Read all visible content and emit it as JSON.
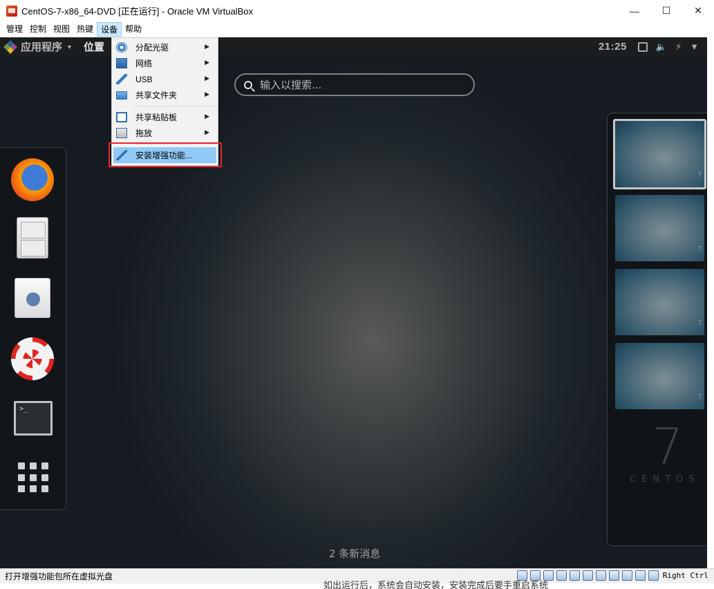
{
  "window": {
    "title": "CentOS-7-x86_64-DVD [正在运行] - Oracle VM VirtualBox",
    "minimize": "—",
    "maximize": "☐",
    "close": "✕"
  },
  "menubar": {
    "items": [
      "管理",
      "控制",
      "视图",
      "热键",
      "设备",
      "帮助"
    ],
    "active_index": 4
  },
  "guest": {
    "top_panel": {
      "apps_label": "应用程序",
      "places_label": "位置",
      "clock": "21:25"
    },
    "search": {
      "placeholder": "输入以搜索..."
    },
    "dash_apps": [
      "firefox-icon",
      "files-icon",
      "software-icon",
      "help-icon",
      "terminal-icon"
    ],
    "terminal_prompt": ">_",
    "workspace_count": 4,
    "workspace_mark": "7",
    "watermark": {
      "number": "7",
      "word": "CENTOS"
    },
    "notifications": "2 条新消息"
  },
  "devices_menu": {
    "items": [
      {
        "label": "分配光驱",
        "icon": "optical-drive-icon",
        "submenu": true
      },
      {
        "label": "网络",
        "icon": "network-icon",
        "submenu": true
      },
      {
        "label": "USB",
        "icon": "usb-icon",
        "submenu": true
      },
      {
        "label": "共享文件夹",
        "icon": "shared-folder-icon",
        "submenu": true
      },
      {
        "label": "共享粘贴板",
        "icon": "clipboard-icon",
        "submenu": true
      },
      {
        "label": "拖放",
        "icon": "drag-drop-icon",
        "submenu": true
      },
      {
        "label": "安装增强功能...",
        "icon": "guest-additions-icon",
        "submenu": false,
        "highlighted": true
      }
    ],
    "highlight_color": "#e8252b"
  },
  "statusbar": {
    "text": "打开增强功能包所在虚拟光盘",
    "host_key": "Right Ctrl"
  },
  "background_fragment": "如出运行后，系统会自动安装，安装完成后要手重启系统"
}
